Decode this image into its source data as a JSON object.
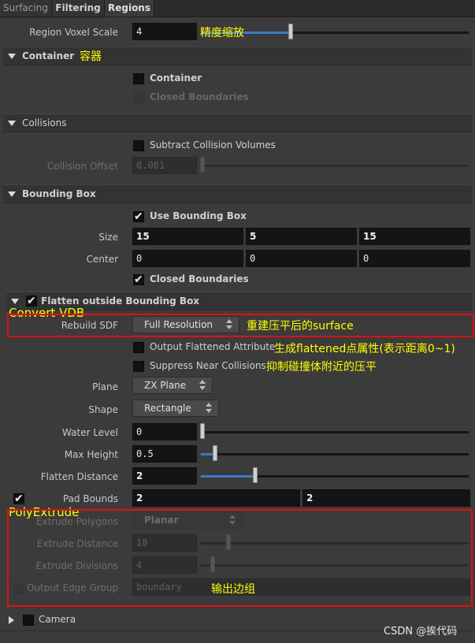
{
  "tabs": [
    "Surfacing",
    "Filtering",
    "Regions"
  ],
  "region_voxel_scale": {
    "label": "Region Voxel Scale",
    "value": "4",
    "slider_fraction": 0.27
  },
  "container": {
    "title": "Container",
    "container_cb": "Container",
    "closed_boundaries_cb": "Closed Boundaries"
  },
  "collisions": {
    "title": "Collisions",
    "subtract_cb": "Subtract Collision Volumes",
    "offset_label": "Collision Offset",
    "offset_value": "0.001"
  },
  "bounding_box": {
    "title": "Bounding Box",
    "use_cb": "Use Bounding Box",
    "size_label": "Size",
    "size": [
      "15",
      "5",
      "15"
    ],
    "center_label": "Center",
    "center": [
      "0",
      "0",
      "0"
    ],
    "closed_cb": "Closed Boundaries"
  },
  "flatten": {
    "title": "Flatten outside Bounding Box",
    "rebuild_label": "Rebuild SDF",
    "rebuild_value": "Full Resolution",
    "output_attr_cb": "Output Flattened Attribute",
    "suppress_cb": "Suppress Near Collisions",
    "plane_label": "Plane",
    "plane_value": "ZX Plane",
    "shape_label": "Shape",
    "shape_value": "Rectangle",
    "water_label": "Water Level",
    "water_value": "0",
    "water_fraction": 0.0,
    "max_height_label": "Max Height",
    "max_height_value": "0.5",
    "max_height_fraction": 0.05,
    "flatten_dist_label": "Flatten Distance",
    "flatten_dist_value": "2",
    "flatten_dist_fraction": 0.2,
    "pad_bounds_label": "Pad Bounds",
    "pad_bounds": [
      "2",
      "2"
    ],
    "extrude_polygons_label": "Extrude Polygons",
    "extrude_polygons_value": "Planar",
    "extrude_distance_label": "Extrude Distance",
    "extrude_distance_value": "10",
    "extrude_divisions_label": "Extrude Divisions",
    "extrude_divisions_value": "4",
    "output_edge_label": "Output Edge Group",
    "output_edge_value": "boundary"
  },
  "camera": {
    "title": "Camera"
  },
  "annotations": {
    "voxel": "精度缩放",
    "container": "容器",
    "convert_vdb": "Convert VDB",
    "rebuild": "重建压平后的surface",
    "output_attr": "生成flattened点属性(表示距离0~1)",
    "suppress": "抑制碰撞体附近的压平",
    "polyextrude": "PolyExtrude",
    "output_edge": "输出边组"
  },
  "watermark": "CSDN @挨代码",
  "colors": {
    "annotation": "#ffff00",
    "highlight_box": "#e01010",
    "slider_fill": "#3c78c8"
  }
}
